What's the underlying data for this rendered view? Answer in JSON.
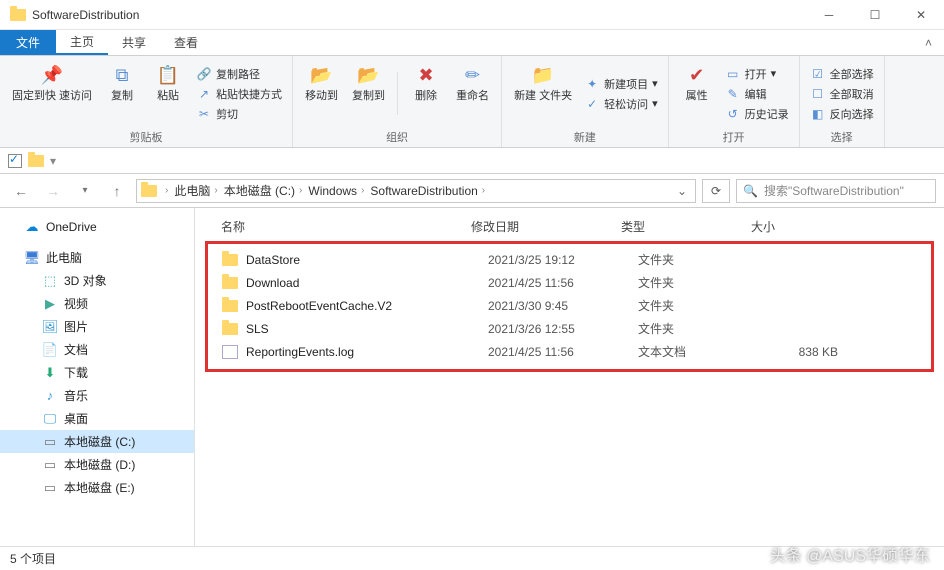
{
  "title": "SoftwareDistribution",
  "tabs": {
    "file": "文件",
    "home": "主页",
    "share": "共享",
    "view": "查看"
  },
  "ribbon": {
    "pin": "固定到快\n速访问",
    "copy": "复制",
    "paste": "粘贴",
    "copy_path": "复制路径",
    "paste_shortcut": "粘贴快捷方式",
    "cut": "剪切",
    "clipboard_group": "剪贴板",
    "move_to": "移动到",
    "copy_to": "复制到",
    "delete": "删除",
    "rename": "重命名",
    "organize_group": "组织",
    "new_folder": "新建\n文件夹",
    "new_item": "新建项目",
    "easy_access": "轻松访问",
    "new_group": "新建",
    "properties": "属性",
    "open": "打开",
    "edit": "编辑",
    "history": "历史记录",
    "open_group": "打开",
    "select_all": "全部选择",
    "select_none": "全部取消",
    "invert_selection": "反向选择",
    "select_group": "选择"
  },
  "breadcrumb": [
    "此电脑",
    "本地磁盘 (C:)",
    "Windows",
    "SoftwareDistribution"
  ],
  "search_placeholder": "搜索\"SoftwareDistribution\"",
  "columns": {
    "name": "名称",
    "date": "修改日期",
    "type": "类型",
    "size": "大小"
  },
  "sidebar": {
    "onedrive": "OneDrive",
    "this_pc": "此电脑",
    "objects3d": "3D 对象",
    "videos": "视频",
    "pictures": "图片",
    "documents": "文档",
    "downloads": "下载",
    "music": "音乐",
    "desktop": "桌面",
    "drive_c": "本地磁盘 (C:)",
    "drive_d": "本地磁盘 (D:)",
    "drive_e": "本地磁盘 (E:)"
  },
  "files": [
    {
      "name": "DataStore",
      "date": "2021/3/25 19:12",
      "type": "文件夹",
      "size": "",
      "kind": "folder"
    },
    {
      "name": "Download",
      "date": "2021/4/25 11:56",
      "type": "文件夹",
      "size": "",
      "kind": "folder"
    },
    {
      "name": "PostRebootEventCache.V2",
      "date": "2021/3/30 9:45",
      "type": "文件夹",
      "size": "",
      "kind": "folder"
    },
    {
      "name": "SLS",
      "date": "2021/3/26 12:55",
      "type": "文件夹",
      "size": "",
      "kind": "folder"
    },
    {
      "name": "ReportingEvents.log",
      "date": "2021/4/25 11:56",
      "type": "文本文档",
      "size": "838 KB",
      "kind": "file"
    }
  ],
  "status": "5 个项目",
  "watermark": "头条 @ASUS华硕华东"
}
